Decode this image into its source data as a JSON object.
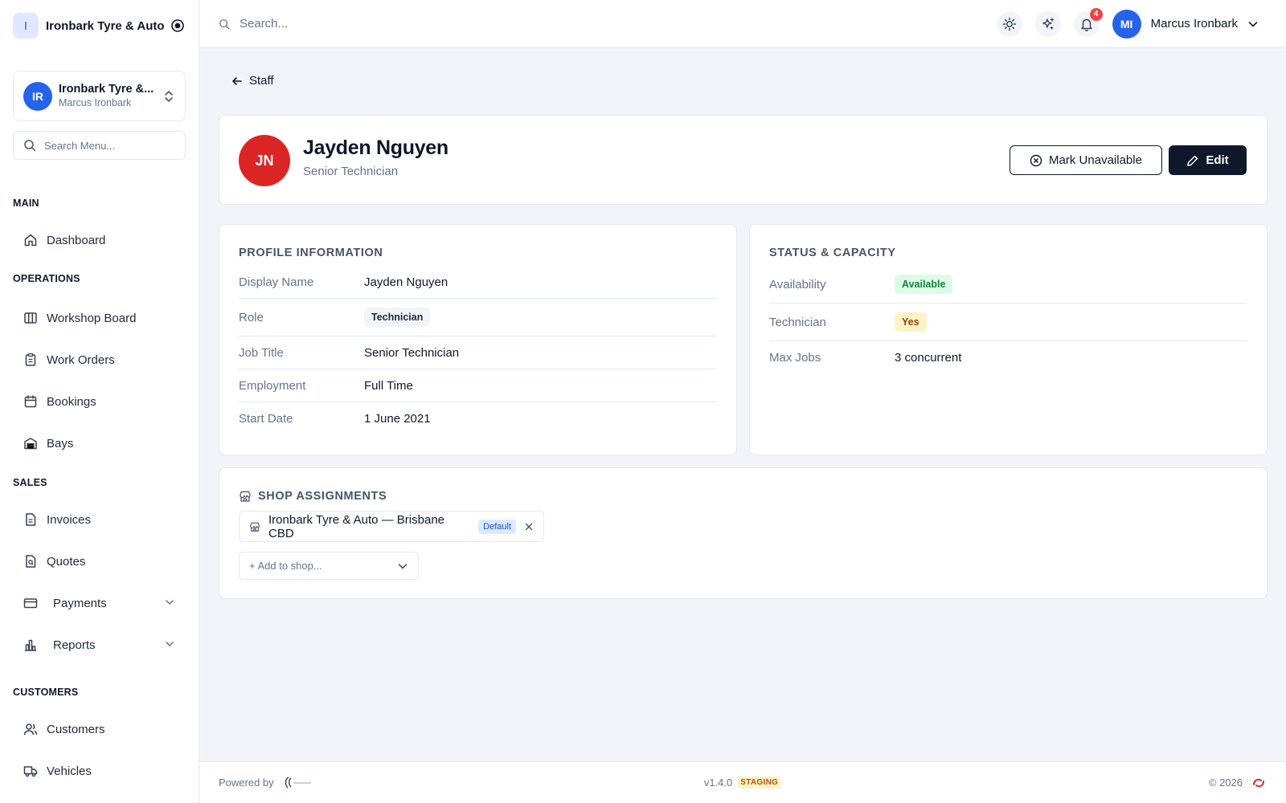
{
  "sidebar": {
    "brand_initial": "I",
    "brand_name": "Ironbark Tyre & Auto",
    "org": {
      "initials": "IR",
      "name": "Ironbark Tyre &...",
      "user": "Marcus Ironbark"
    },
    "search_placeholder": "Search Menu...",
    "sections": {
      "main": "MAIN",
      "operations": "OPERATIONS",
      "sales": "SALES",
      "customers": "CUSTOMERS"
    },
    "items": {
      "dashboard": "Dashboard",
      "workshop_board": "Workshop Board",
      "work_orders": "Work Orders",
      "bookings": "Bookings",
      "bays": "Bays",
      "invoices": "Invoices",
      "quotes": "Quotes",
      "payments": "Payments",
      "reports": "Reports",
      "customers": "Customers",
      "vehicles": "Vehicles"
    }
  },
  "topbar": {
    "search_placeholder": "Search...",
    "notification_count": "4",
    "user_initials": "MI",
    "user_name": "Marcus Ironbark"
  },
  "page": {
    "back_label": "Staff",
    "staff": {
      "initials": "JN",
      "name": "Jayden Nguyen",
      "title": "Senior Technician"
    },
    "actions": {
      "mark_unavailable": "Mark Unavailable",
      "edit": "Edit"
    },
    "profile": {
      "heading": "PROFILE INFORMATION",
      "rows": [
        {
          "key": "Display Name",
          "value": "Jayden Nguyen"
        },
        {
          "key": "Role",
          "value": "Technician"
        },
        {
          "key": "Job Title",
          "value": "Senior Technician"
        },
        {
          "key": "Employment",
          "value": "Full Time"
        },
        {
          "key": "Start Date",
          "value": "1 June 2021"
        }
      ]
    },
    "status": {
      "heading": "STATUS & CAPACITY",
      "rows": [
        {
          "key": "Availability",
          "value": "Available"
        },
        {
          "key": "Technician",
          "value": "Yes"
        },
        {
          "key": "Max Jobs",
          "value": "3 concurrent"
        }
      ]
    },
    "shops": {
      "heading": "SHOP ASSIGNMENTS",
      "assignment": "Ironbark Tyre & Auto — Brisbane CBD",
      "default_badge": "Default",
      "add_placeholder": "+ Add to shop..."
    }
  },
  "footer": {
    "powered_by": "Powered by",
    "version": "v1.4.0",
    "env": "STAGING",
    "copyright": "© 2026"
  },
  "colors": {
    "accent": "#2563eb",
    "staff_avatar": "#dc2626",
    "primary_button": "#0f172a",
    "available": "#dcfce7",
    "yes": "#fef3c7"
  }
}
